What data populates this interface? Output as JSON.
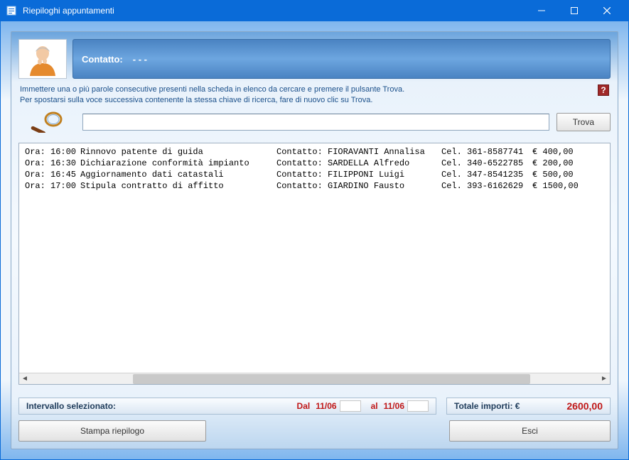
{
  "window": {
    "title": "Riepiloghi appuntamenti"
  },
  "contact": {
    "label": "Contatto:",
    "value": "- - -"
  },
  "instructions": {
    "line1": "Immettere una o più parole consecutive presenti nella scheda in elenco da cercare e premere il pulsante Trova.",
    "line2": "Per spostarsi sulla voce successiva contenente la stessa chiave di ricerca, fare di nuovo clic su Trova."
  },
  "search": {
    "value": "",
    "button": "Trova"
  },
  "list": {
    "time_prefix": "Ora:",
    "contact_prefix": "Contatto:",
    "phone_prefix": "Cel.",
    "currency": "€",
    "rows": [
      {
        "time": "16:00",
        "desc": "Rinnovo patente di guida",
        "contact_name": "FIORAVANTI Annalisa",
        "phone": "361-8587741",
        "amount": "400,00"
      },
      {
        "time": "16:30",
        "desc": "Dichiarazione conformità impianto",
        "contact_name": "SARDELLA Alfredo",
        "phone": "340-6522785",
        "amount": "200,00"
      },
      {
        "time": "16:45",
        "desc": "Aggiornamento dati catastali",
        "contact_name": "FILIPPONI Luigi",
        "phone": "347-8541235",
        "amount": "500,00"
      },
      {
        "time": "17:00",
        "desc": "Stipula contratto di affitto",
        "contact_name": "GIARDINO Fausto",
        "phone": "393-6162629",
        "amount": "1500,00"
      }
    ]
  },
  "summary": {
    "interval_label": "Intervallo selezionato:",
    "from_label": "Dal",
    "from_date": "11/06",
    "to_label": "al",
    "to_date": "11/06",
    "total_label": "Totale importi: €",
    "total_value": "2600,00"
  },
  "buttons": {
    "print": "Stampa riepilogo",
    "exit": "Esci"
  }
}
